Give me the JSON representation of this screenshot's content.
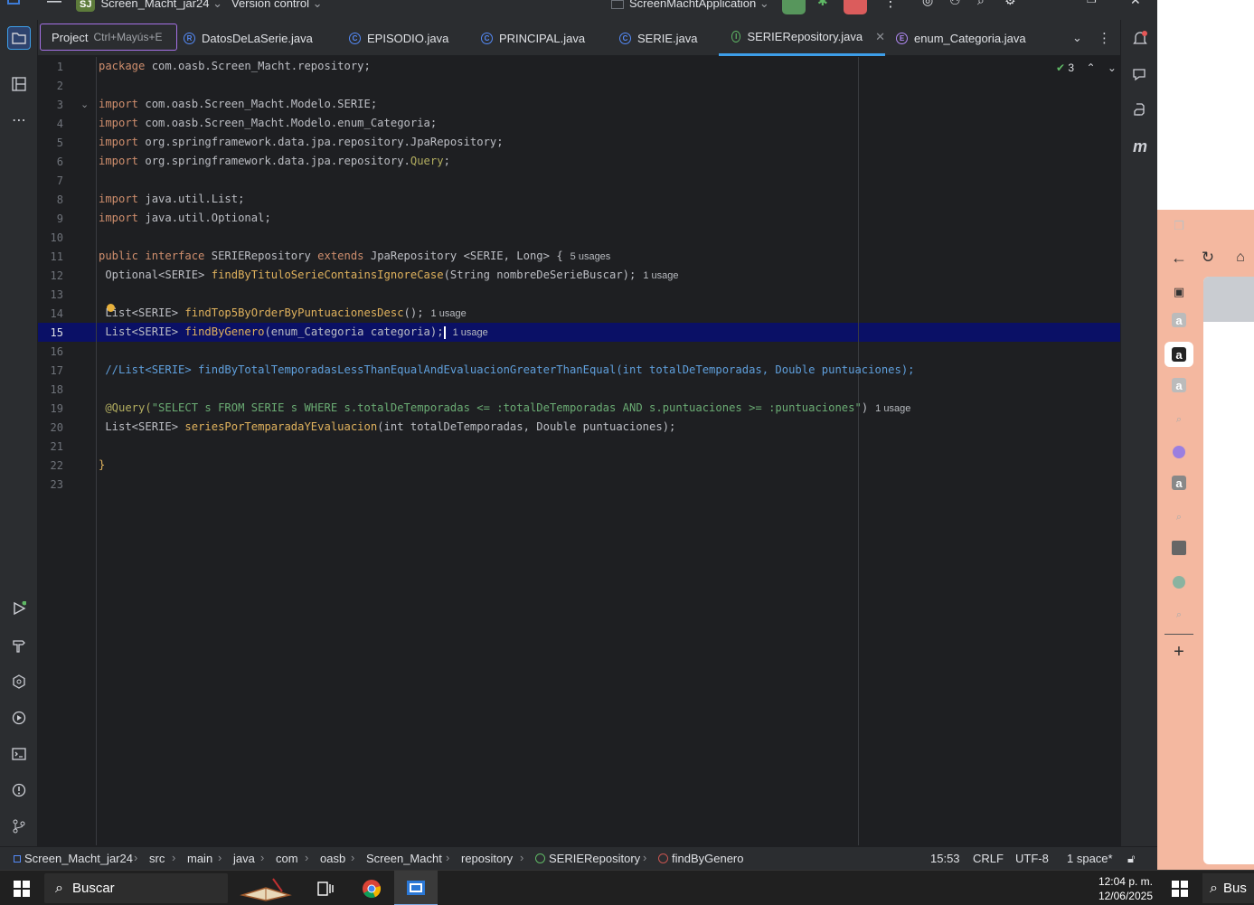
{
  "topbar": {
    "project_badge": "SJ",
    "project_name": "Screen_Macht_jar24",
    "vcs": "Version control",
    "run_config": "ScreenMachtApplication"
  },
  "project_popup": {
    "label": "Project",
    "shortcut": "Ctrl+Mayús+E"
  },
  "tabs": [
    {
      "label": "DatosDeLaSerie.java",
      "icon": "record-icon",
      "glyph": "R"
    },
    {
      "label": "EPISODIO.java",
      "icon": "class-icon",
      "glyph": "C"
    },
    {
      "label": "PRINCIPAL.java",
      "icon": "class-icon",
      "glyph": "C"
    },
    {
      "label": "SERIE.java",
      "icon": "class-icon",
      "glyph": "C"
    },
    {
      "label": "SERIERepository.java",
      "icon": "interface-icon",
      "glyph": "I"
    },
    {
      "label": "enum_Categoria.java",
      "icon": "enum-icon",
      "glyph": "E"
    }
  ],
  "editor": {
    "inspection_count": "3",
    "current_line": 15,
    "line_numbers": [
      "1",
      "2",
      "3",
      "4",
      "5",
      "6",
      "7",
      "8",
      "9",
      "10",
      "11",
      "12",
      "13",
      "14",
      "15",
      "16",
      "17",
      "18",
      "19",
      "20",
      "21",
      "22",
      "23"
    ],
    "lines": {
      "l1_kw": "package",
      "l1_rest": " com.oasb.Screen_Macht.repository;",
      "l3_kw": "import",
      "l3_rest": " com.oasb.Screen_Macht.Modelo.SERIE;",
      "l4_kw": "import",
      "l4_rest": " com.oasb.Screen_Macht.Modelo.enum_Categoria;",
      "l5_kw": "import",
      "l5_rest": " org.springframework.data.jpa.repository.JpaRepository;",
      "l6_kw": "import",
      "l6_rest": " org.springframework.data.jpa.repository.",
      "l6_ann": "Query",
      "l6_end": ";",
      "l8_kw": "import",
      "l8_rest": " java.util.List;",
      "l9_kw": "import",
      "l9_rest": " java.util.Optional;",
      "l11_kw1": "public interface",
      "l11_name": " SERIERepository ",
      "l11_kw2": "extends",
      "l11_rest": " JpaRepository <SERIE, Long> {",
      "l11_hint": "5 usages",
      "l12_type": " Optional<SERIE> ",
      "l12_fn": "findByTituloSerieContainsIgnoreCase",
      "l12_rest": "(String nombreDeSerieBuscar);",
      "l12_hint": "1 usage",
      "l14_type": " List<SERIE> ",
      "l14_fn": "findTop5ByOrderByPuntuacionesDesc",
      "l14_rest": "();",
      "l14_hint": "1 usage",
      "l15_type": " List<SERIE> ",
      "l15_fn": "findByGenero",
      "l15_rest": "(enum_Categoria categoria);",
      "l15_hint": "1 usage",
      "l17_cmt": " //List<SERIE> findByTotalTemporadasLessThanEqualAndEvaluacionGreaterThanEqual(int totalDeTemporadas, Double puntuaciones);",
      "l19_ann": " @Query(",
      "l19_str": "\"SELECT s FROM SERIE s WHERE s.totalDeTemporadas <= :totalDeTemporadas AND s.puntuaciones >= :puntuaciones\"",
      "l19_end": ")",
      "l19_hint": "1 usage",
      "l20_type": " List<SERIE> ",
      "l20_fn": "seriesPorTemparadaYEvaluacion",
      "l20_rest": "(int totalDeTemporadas, Double puntuaciones);",
      "l22": "}"
    }
  },
  "statusbar": {
    "breadcrumbs": [
      "Screen_Macht_jar24",
      "src",
      "main",
      "java",
      "com",
      "oasb",
      "Screen_Macht",
      "repository",
      "SERIERepository",
      "findByGenero"
    ],
    "position": "15:53",
    "line_sep": "CRLF",
    "encoding": "UTF-8",
    "indent": "1 space*"
  },
  "taskbar": {
    "search_placeholder": "Buscar",
    "time": "12:04 p. m.",
    "date": "12/06/2025",
    "search2": "Bus"
  },
  "colors": {
    "accent": "#3d9ee9",
    "keyword": "#cf8e6d",
    "string": "#6aab73",
    "function": "#e0b25d",
    "selection": "#0a1066"
  }
}
